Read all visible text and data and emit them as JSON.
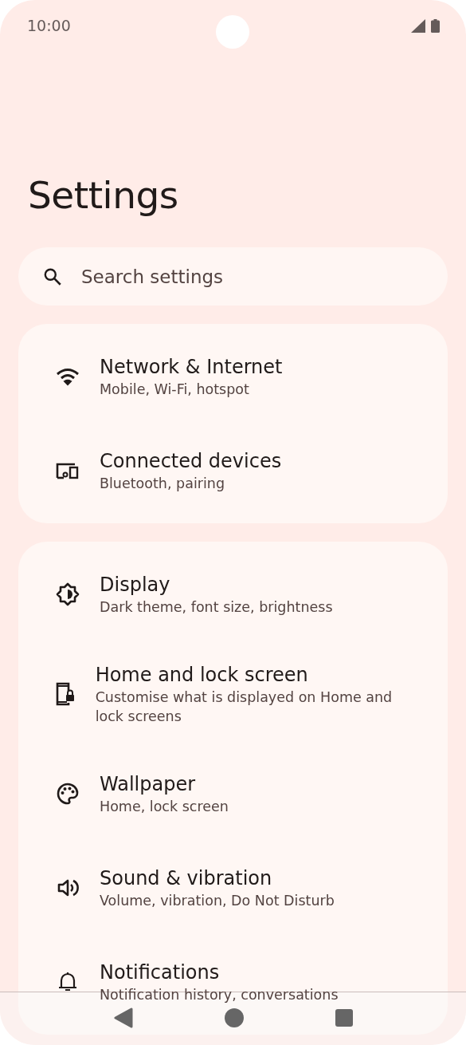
{
  "status_bar": {
    "time": "10:00"
  },
  "title": "Settings",
  "search": {
    "placeholder": "Search settings"
  },
  "groups": [
    {
      "items": [
        {
          "kind": "wifi",
          "title": "Network & Internet",
          "subtitle": "Mobile, Wi-Fi, hotspot"
        },
        {
          "kind": "devices",
          "title": "Connected devices",
          "subtitle": "Bluetooth, pairing"
        }
      ]
    },
    {
      "items": [
        {
          "kind": "display",
          "title": "Display",
          "subtitle": "Dark theme, font size, brightness"
        },
        {
          "kind": "lockscreen",
          "title": "Home and lock screen",
          "subtitle": "Customise what is displayed on Home and lock screens"
        },
        {
          "kind": "palette",
          "title": "Wallpaper",
          "subtitle": "Home, lock screen"
        },
        {
          "kind": "sound",
          "title": "Sound & vibration",
          "subtitle": "Volume, vibration, Do Not Disturb"
        },
        {
          "kind": "bell",
          "title": "Notifications",
          "subtitle": "Notification history, conversations"
        }
      ]
    }
  ]
}
